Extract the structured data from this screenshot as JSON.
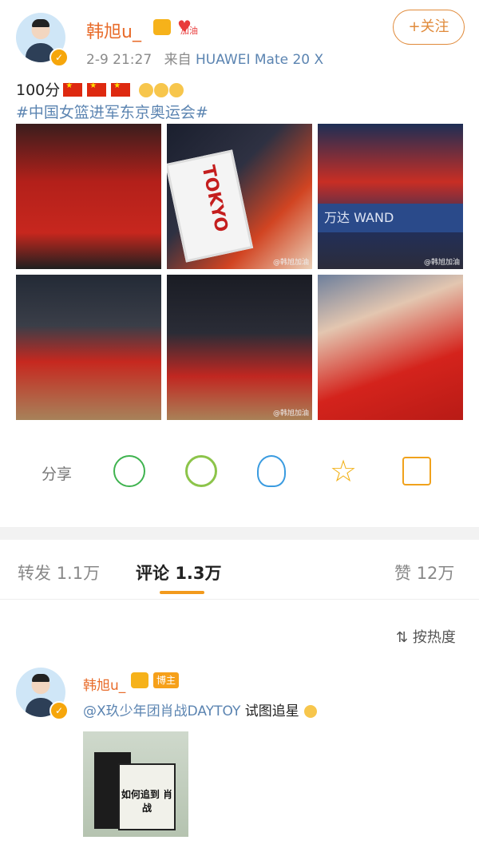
{
  "post": {
    "username": "韩旭u_",
    "badge_text": "加油",
    "time": "2-9 21:27",
    "source_prefix": "来自",
    "device": "HUAWEI Mate 20 X",
    "follow_label": "关注",
    "text": "100分",
    "hashtag": "#中国女篮进军东京奥运会#",
    "photos": [
      {
        "watermark": ""
      },
      {
        "watermark": "@韩旭加油",
        "card_text": "TOKYO"
      },
      {
        "watermark": "@韩旭加油",
        "banner_text": "万达 WAND"
      },
      {
        "watermark": ""
      },
      {
        "watermark": "@韩旭加油"
      },
      {
        "watermark": ""
      }
    ]
  },
  "share": {
    "label": "分享",
    "icons": [
      "wechat-icon",
      "moments-icon",
      "qq-icon",
      "favorite-star-icon",
      "save-image-icon"
    ]
  },
  "tabs": {
    "repost": {
      "label": "转发",
      "count": "1.1万"
    },
    "comment": {
      "label": "评论",
      "count": "1.3万"
    },
    "like": {
      "label": "赞",
      "count": "12万"
    }
  },
  "sort": {
    "label": "按热度"
  },
  "comment": {
    "username": "韩旭u_",
    "role_badge": "博主",
    "mention": "@X玖少年团肖战DAYTOY",
    "text": " 试图追星",
    "meme_text": "如何追到 肖战"
  },
  "colors": {
    "accent": "#e08a3a",
    "link": "#5b84b1",
    "username": "#e86c2b",
    "tab_underline": "#f29a1c"
  }
}
